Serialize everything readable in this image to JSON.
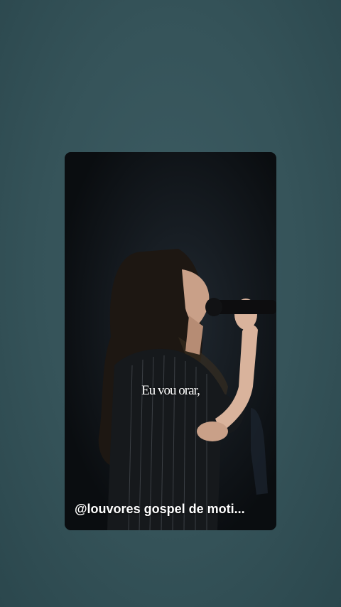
{
  "video": {
    "lyric": "Eu vou orar,",
    "watermark": "@louvores gospel  de moti..."
  },
  "colors": {
    "background": "#2f5057",
    "card": "#0f1417",
    "text": "#ffffff"
  }
}
